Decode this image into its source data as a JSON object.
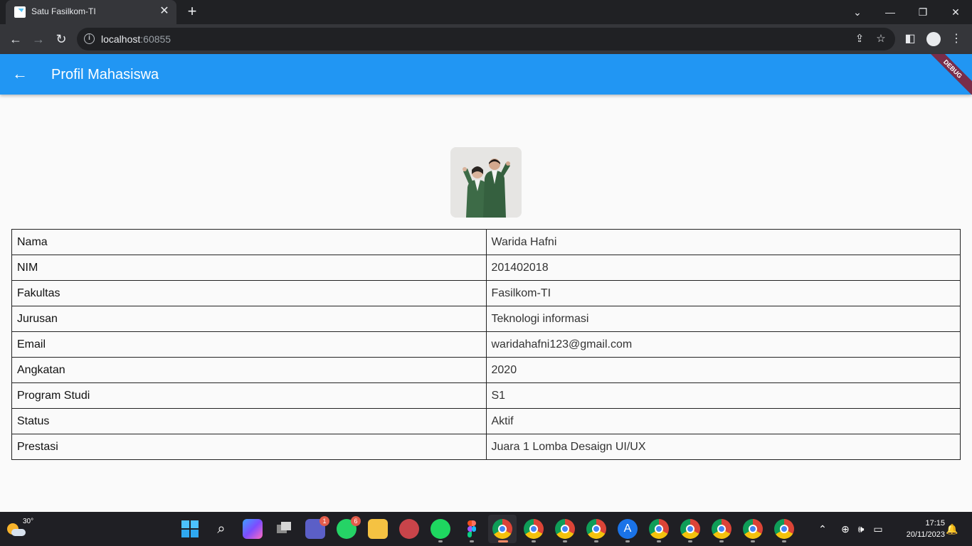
{
  "browser": {
    "tab_title": "Satu Fasilkom-TI",
    "url_host": "localhost",
    "url_port": ":60855"
  },
  "app": {
    "title": "Profil Mahasiswa",
    "debug_banner": "DEBUG"
  },
  "profile": {
    "rows": [
      {
        "label": "Nama",
        "value": "Warida Hafni"
      },
      {
        "label": "NIM",
        "value": "201402018"
      },
      {
        "label": "Fakultas",
        "value": "Fasilkom-TI"
      },
      {
        "label": "Jurusan",
        "value": "Teknologi informasi"
      },
      {
        "label": "Email",
        "value": "waridahafni123@gmail.com"
      },
      {
        "label": "Angkatan",
        "value": "2020"
      },
      {
        "label": "Program Studi",
        "value": "S1"
      },
      {
        "label": "Status",
        "value": "Aktif"
      },
      {
        "label": "Prestasi",
        "value": "Juara 1 Lomba Desaign UI/UX"
      }
    ]
  },
  "taskbar": {
    "temperature": "30°",
    "teams_badge": "1",
    "whatsapp_badge": "6",
    "time": "17:15",
    "date": "20/11/2023"
  },
  "colors": {
    "app_bar": "#2196f3",
    "browser_frame": "#202124",
    "taskbar": "#1f1f24"
  }
}
